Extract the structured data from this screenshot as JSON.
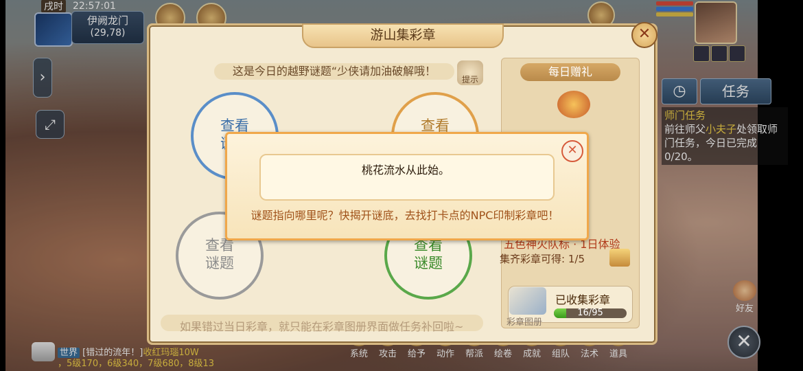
{
  "status": {
    "period": "戌时",
    "time": "22:57:01"
  },
  "location": {
    "name": "伊阙龙门",
    "coords": "(29,78)"
  },
  "tasks": {
    "clock_icon": "clock-icon",
    "tab_label": "任务",
    "entry_title": "师门任务",
    "entry_text_a": "前往师父",
    "entry_npc": "小夫子",
    "entry_text_b": "处领取师门任务，今日已完成0/20。"
  },
  "panel": {
    "title": "游山集彩章",
    "riddle_prompt": "这是今日的越野谜题“少侠请加油破解哦！",
    "hint_label": "提示",
    "circles": [
      {
        "label_line1": "查看",
        "label_line2": "谜题",
        "color": "#5a8ec8"
      },
      {
        "label_line1": "查看",
        "label_line2": "谜题",
        "color": "#e0a04a"
      },
      {
        "label_line1": "查看",
        "label_line2": "谜题",
        "color": "#9a9a9a"
      },
      {
        "label_line1": "查看",
        "label_line2": "谜题",
        "color": "#5aa84a"
      }
    ],
    "footer_note": "如果错过当日彩章，就只能在彩章图册界面做任务补回啦~",
    "reward": {
      "title": "每日赠礼",
      "item_name": "五色神火队标 · 1日体验",
      "collect_prompt": "集齐彩章可得:",
      "collect_progress": "1/5",
      "collected_label": "已收集彩章",
      "collected_count": "16/95",
      "collected_fraction": 0.168,
      "album_label": "彩章图册"
    }
  },
  "dialog": {
    "message": "桃花流水从此始。",
    "hint": "谜题指向哪里呢？快揭开谜底，去找打卡点的NPC印制彩章吧！"
  },
  "bottom_menu": [
    "系统",
    "攻击",
    "给予",
    "动作",
    "帮派",
    "绘卷",
    "成就",
    "组队",
    "法术",
    "道具"
  ],
  "friends_label": "好友",
  "chat": {
    "channel": "世界",
    "line1_a": "[错过的流年！]",
    "line1_b": "收红玛瑙10W",
    "line2": "，5级170，6级340，7级680，8级13"
  },
  "colors": {
    "accent_orange": "#f0a74a",
    "reward_red": "#b03a1a",
    "progress_green": "#5ac02a"
  }
}
